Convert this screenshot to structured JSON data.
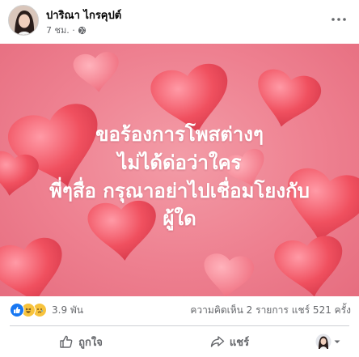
{
  "post": {
    "author": "ปาริณา ไกรคุปต์",
    "time": "7 ชม. ·",
    "privacy_icon": "globe-icon"
  },
  "content": {
    "lines": [
      "ขอร้องการโพสต่างๆ",
      "ไม่ได้ด่อว่าใคร",
      "พี่ๆสื่อ กรุณาอย่าไปเชื่อมโยงกับ",
      "ผู้ใด"
    ],
    "background": "pink-hearts",
    "text_color": "#ffffff"
  },
  "stats": {
    "reaction_icons": [
      "like-icon",
      "haha-icon",
      "sad-icon"
    ],
    "reaction_count": "3.9 พัน",
    "comments": "ความคิดเห็น 2 รายการ",
    "shares": "แชร์ 521 ครั้ง"
  },
  "actions": {
    "like_label": "ถูกใจ",
    "share_label": "แชร์"
  },
  "colors": {
    "like_blue": "#1877f2",
    "reaction_yellow": "#f7c33d",
    "secondary_text": "#65676b"
  }
}
